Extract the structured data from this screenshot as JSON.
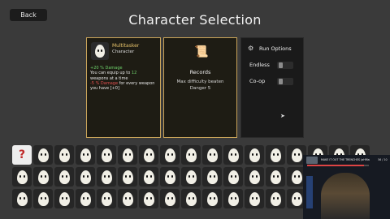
{
  "header": {
    "back_label": "Back",
    "title": "Character Selection"
  },
  "character": {
    "name": "Multitasker",
    "type": "Character",
    "description": [
      {
        "text": "+20 % Damage",
        "color": "green"
      },
      {
        "text": "You can equip up to ",
        "color": "white"
      },
      {
        "text": "12",
        "color": "green"
      },
      {
        "text": " weapons at a time",
        "color": "white"
      },
      {
        "text": "-5 % Damage",
        "color": "red"
      },
      {
        "text": " for every weapon you have [+0]",
        "color": "white"
      }
    ],
    "icon": "egg-character-icon"
  },
  "records": {
    "icon": "scroll-icon",
    "title": "Records",
    "line1": "Max difficulty beaten",
    "line2": "Danger 5"
  },
  "run_options": {
    "icon": "settings-icon",
    "title": "Run Options",
    "options": [
      {
        "label": "Endless",
        "enabled": false
      },
      {
        "label": "Co-op",
        "enabled": false
      }
    ]
  },
  "character_grid": {
    "random_label": "?",
    "count": 51
  },
  "stream_overlay": {
    "title": "MAKE IT OUT THE TRENCHES (aHMaim)",
    "followers": "56 / 10",
    "progress": 0.92
  },
  "colors": {
    "accent": "#c9a45a",
    "name": "#e8c46b",
    "positive": "#6fd36b",
    "negative": "#e05050",
    "background": "#3a3a3a"
  }
}
